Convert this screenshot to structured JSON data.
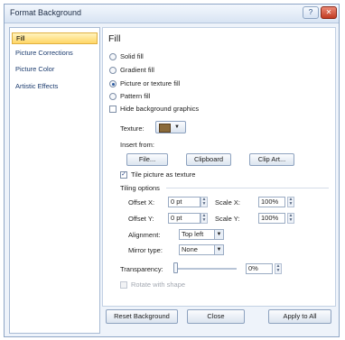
{
  "title": "Format Background",
  "titlebar": {
    "help_glyph": "?",
    "close_glyph": "✕"
  },
  "sidebar": {
    "items": [
      {
        "label": "Fill",
        "selected": true
      },
      {
        "label": "Picture Corrections"
      },
      {
        "label": "Picture Color"
      },
      {
        "label": "Artistic Effects"
      }
    ]
  },
  "fill": {
    "heading": "Fill",
    "options": [
      {
        "label": "Solid fill",
        "checked": false
      },
      {
        "label": "Gradient fill",
        "checked": false
      },
      {
        "label": "Picture or texture fill",
        "checked": true
      },
      {
        "label": "Pattern fill",
        "checked": false
      }
    ],
    "hide_bg_label": "Hide background graphics",
    "texture_label": "Texture:",
    "insert_from_label": "Insert from:",
    "buttons": {
      "file": "File...",
      "clipboard": "Clipboard",
      "clip_art": "Clip Art..."
    },
    "tile_label": "Tile picture as texture",
    "tile_checked": true,
    "tiling_label": "Tiling options",
    "offset_x_label": "Offset X:",
    "offset_x_value": "0 pt",
    "offset_y_label": "Offset Y:",
    "offset_y_value": "0 pt",
    "scale_x_label": "Scale X:",
    "scale_x_value": "100%",
    "scale_y_label": "Scale Y:",
    "scale_y_value": "100%",
    "alignment_label": "Alignment:",
    "alignment_value": "Top left",
    "mirror_label": "Mirror type:",
    "mirror_value": "None",
    "transparency_label": "Transparency:",
    "transparency_value": "0%",
    "rotate_label": "Rotate with shape"
  },
  "footer": {
    "reset": "Reset Background",
    "close": "Close",
    "apply_all": "Apply to All"
  },
  "colors": {
    "selected_bg": "#ffd666",
    "accent": "#2b5aa0",
    "dialog_bg": "#eef3fa"
  }
}
